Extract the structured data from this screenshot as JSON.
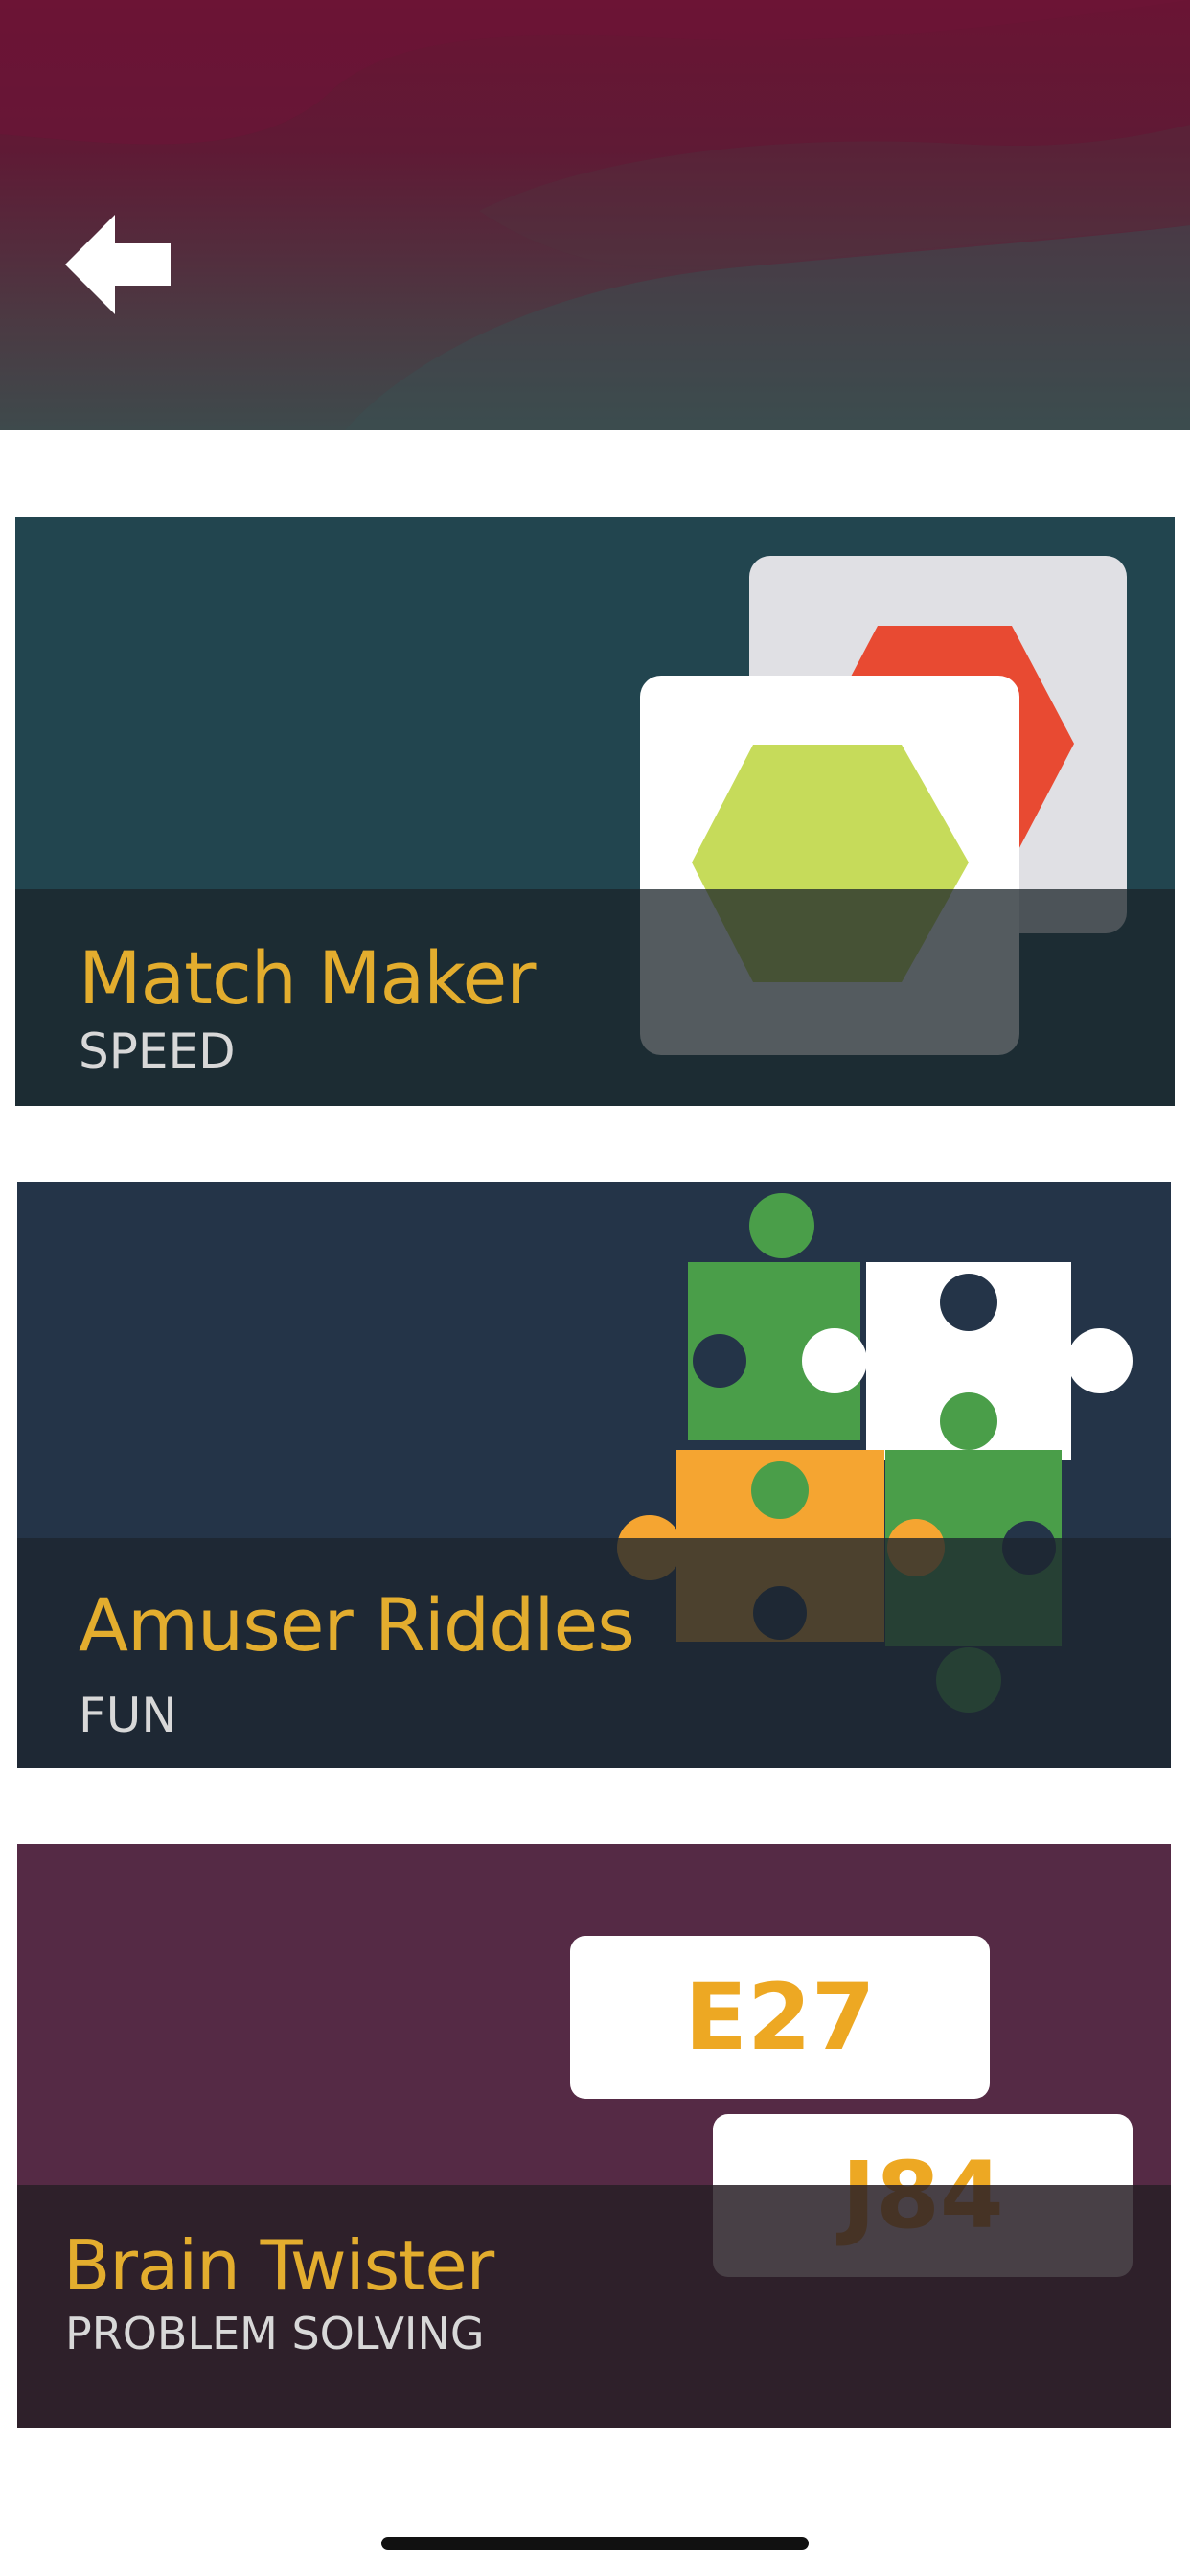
{
  "header": {
    "back_icon": "arrow-left-icon",
    "colors": {
      "top": "#6a1434",
      "bottom": "#3e4a4c"
    }
  },
  "cards": [
    {
      "title": "Match Maker",
      "subtitle": "SPEED",
      "icon": "hexagon-cards-icon",
      "colors": {
        "bg": "#22454f",
        "band": "#1b2a2f",
        "hex_front": "#c6db5a",
        "hex_back": "#e84a32"
      }
    },
    {
      "title": "Amuser Riddles",
      "subtitle": "FUN",
      "icon": "puzzle-pieces-icon",
      "colors": {
        "bg": "#243448",
        "band": "#1c252e",
        "green": "#4a9e49",
        "orange": "#f5a531",
        "white": "#ffffff"
      }
    },
    {
      "title": "Brain Twister",
      "subtitle": "PROBLEM SOLVING",
      "icon": "code-tiles-icon",
      "tiles": [
        "E27",
        "J84"
      ],
      "colors": {
        "bg": "#552a45",
        "band": "#2c2029",
        "tile_text": "#eda823"
      }
    }
  ]
}
